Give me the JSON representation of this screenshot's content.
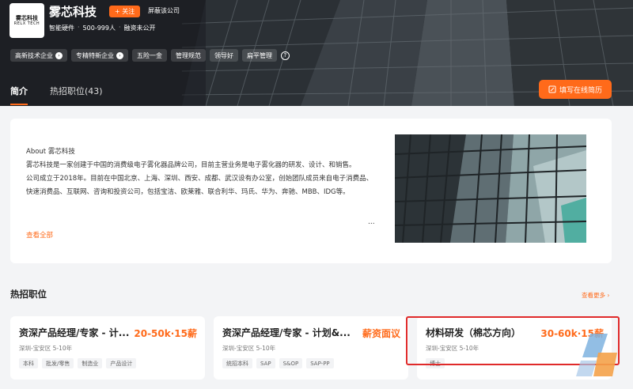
{
  "company": {
    "logo_line1": "雾芯科技",
    "logo_line2": "RELX TECH",
    "name": "雾芯科技",
    "follow_label": "+ 关注",
    "shield_label": "屏蔽该公司",
    "industry": "智能硬件",
    "size": "500-999人",
    "funding": "融资未公开"
  },
  "tags": [
    {
      "label": "高新技术企业"
    },
    {
      "label": "专精特新企业"
    },
    {
      "label": "五险一金"
    },
    {
      "label": "管理规范"
    },
    {
      "label": "领导好"
    },
    {
      "label": "扁平管理"
    }
  ],
  "tabs": {
    "intro": "简介",
    "jobs": "热招职位(43)"
  },
  "resume_button": "填写在线简历",
  "about": {
    "title": "About 雾芯科技",
    "p1": "雾芯科技是一家创建于中国的消费级电子雾化器品牌公司，目前主营业务是电子雾化器的研发、设计、和销售。",
    "p2": "公司成立于2018年。目前在中国北京、上海、深圳、西安、成都、武汉设有办公室，创始团队成员来自电子消费品、快速消费品、互联网、咨询和投资公司，包括宝洁、欧莱雅、联合利华、玛氏、华为、奔驰、MBB、IDG等。",
    "ellipsis": "...",
    "see_all": "查看全部"
  },
  "hot_jobs": {
    "title": "热招职位",
    "see_more": "查看更多",
    "items": [
      {
        "title": "资深产品经理/专家 - 计...",
        "salary": "20-50k·15薪",
        "location": "深圳-宝安区  5-10年",
        "tags": [
          "本科",
          "批发/零售",
          "制造业",
          "产品设计"
        ]
      },
      {
        "title": "资深产品经理/专家 - 计划&...",
        "salary": "薪资面议",
        "location": "深圳-宝安区  5-10年",
        "tags": [
          "统招本科",
          "SAP",
          "S&OP",
          "SAP-PP"
        ]
      },
      {
        "title": "材料研发（棉芯方向）",
        "salary": "30-60k·15薪",
        "location": "深圳-宝安区  5-10年",
        "tags": [
          "博士"
        ]
      }
    ]
  },
  "colors": {
    "accent": "#ff6a1a",
    "highlight": "#e02a2a"
  }
}
